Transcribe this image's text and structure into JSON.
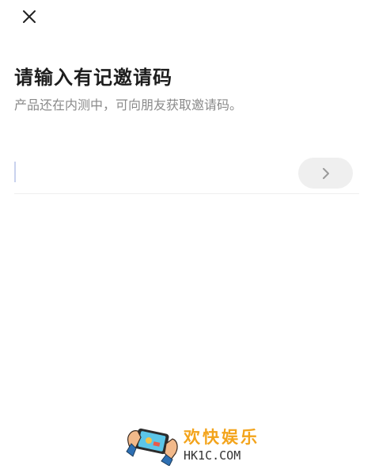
{
  "header": {
    "close_icon": "close-icon"
  },
  "content": {
    "title": "请输入有记邀请码",
    "subtitle": "产品还在内测中，可向朋友获取邀请码。"
  },
  "invite_code": {
    "value": "",
    "placeholder": "",
    "next_icon": "chevron-right-icon"
  },
  "watermark": {
    "name_cn": "欢快娱乐",
    "domain": "HK1C.COM"
  },
  "colors": {
    "caret": "#c9d2ee",
    "button_bg": "#efefef",
    "chevron": "#9a9a9a",
    "watermark_accent": "#f3a41c"
  }
}
